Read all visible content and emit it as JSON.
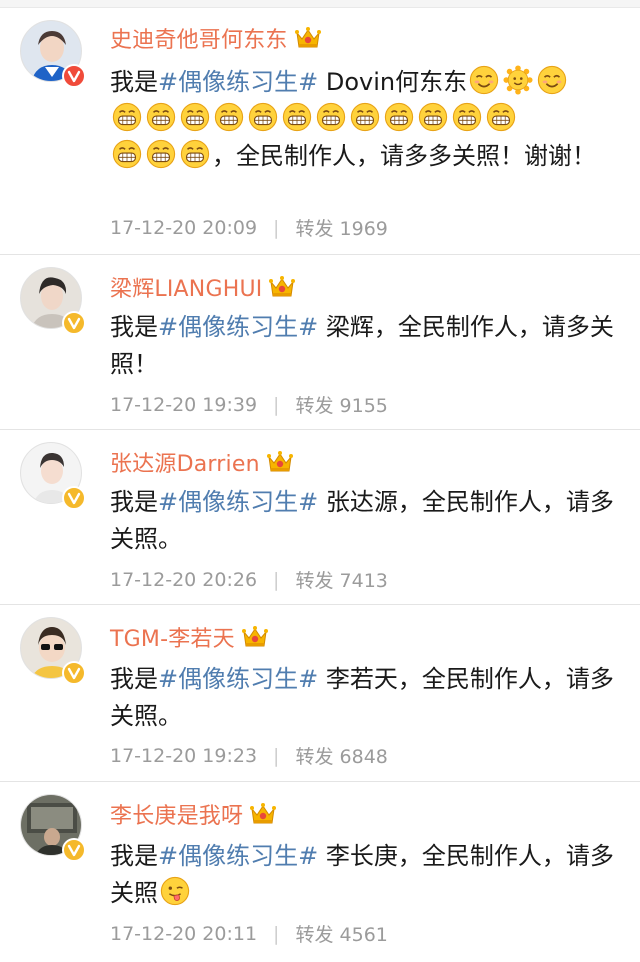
{
  "colors": {
    "username": "#eb7350",
    "hashtag": "#507daf",
    "meta": "#9b9b9b",
    "badge_red": "#f04b3a",
    "badge_yellow": "#f5b92b",
    "crown": "#f7b500"
  },
  "posts": [
    {
      "username": "史迪奇他哥何东东",
      "badge": "red-v",
      "text_before": "我是",
      "hashtag": "#偶像练习生#",
      "text_after": " Dovin何东东",
      "emojis_inline": [
        "smile-emoji",
        "sun-emoji",
        "smile-emoji"
      ],
      "emojis_row": [
        "grin-emoji",
        "grin-emoji",
        "grin-emoji",
        "grin-emoji",
        "grin-emoji",
        "grin-emoji",
        "grin-emoji",
        "grin-emoji",
        "grin-emoji",
        "grin-emoji",
        "grin-emoji",
        "grin-emoji",
        "grin-emoji",
        "grin-emoji",
        "grin-emoji"
      ],
      "text_end": "，全民制作人，请多多关照！谢谢！",
      "time": "17-12-20 20:09",
      "divider": "|",
      "repost_label": "转发",
      "repost_count": "1969"
    },
    {
      "username": "梁辉LIANGHUI",
      "badge": "yellow-v",
      "text_before": "我是",
      "hashtag": "#偶像练习生#",
      "text_after": " 梁辉，全民制作人，请多关照！",
      "time": "17-12-20 19:39",
      "divider": "|",
      "repost_label": "转发",
      "repost_count": "9155"
    },
    {
      "username": "张达源Darrien",
      "badge": "yellow-v",
      "text_before": "我是",
      "hashtag": "#偶像练习生#",
      "text_after": " 张达源，全民制作人，请多关照。",
      "time": "17-12-20 20:26",
      "divider": "|",
      "repost_label": "转发",
      "repost_count": "7413"
    },
    {
      "username": "TGM-李若天",
      "badge": "yellow-v",
      "text_before": "我是",
      "hashtag": "#偶像练习生#",
      "text_after": " 李若天，全民制作人，请多关照。",
      "time": "17-12-20 19:23",
      "divider": "|",
      "repost_label": "转发",
      "repost_count": "6848"
    },
    {
      "username": "李长庚是我呀",
      "badge": "yellow-v",
      "text_before": "我是",
      "hashtag": "#偶像练习生#",
      "text_after": " 李长庚，全民制作人，请多关照",
      "emoji_end": "tongue-emoji",
      "time": "17-12-20 20:11",
      "divider": "|",
      "repost_label": "转发",
      "repost_count": "4561"
    }
  ]
}
